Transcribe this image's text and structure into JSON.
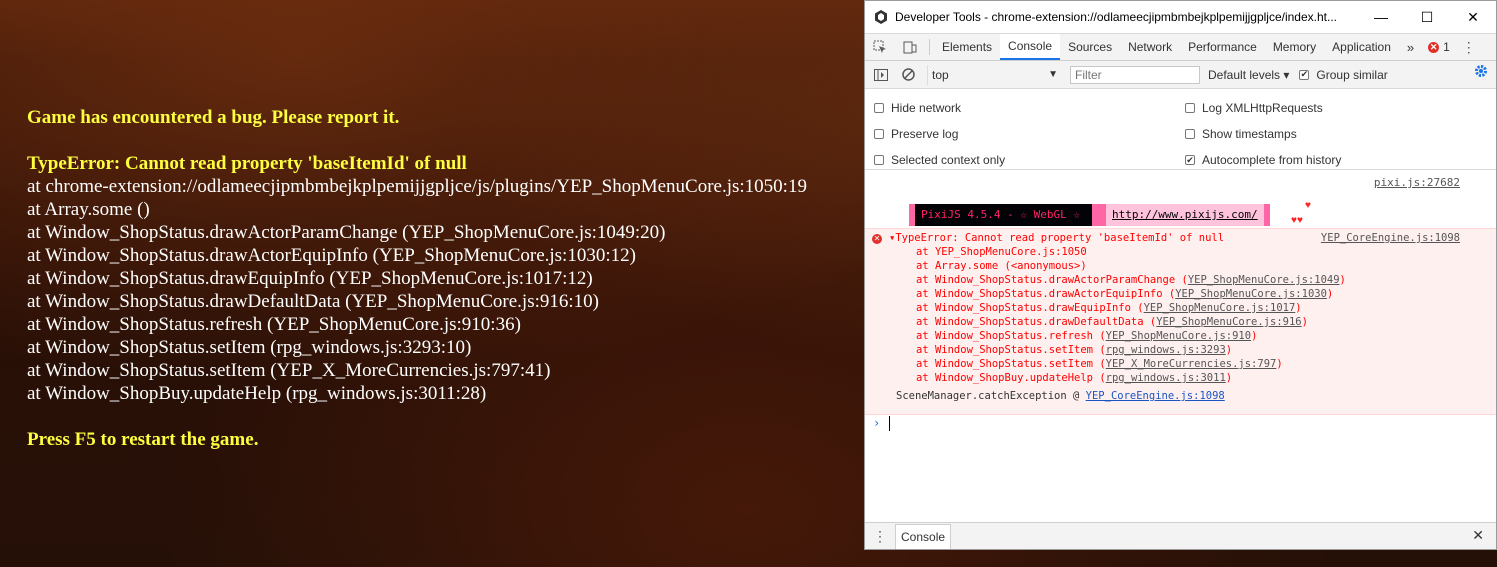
{
  "game": {
    "heading": "Game has encountered a bug. Please report it.",
    "error_title": "TypeError: Cannot read property 'baseItemId' of null",
    "stack": [
      "at chrome-extension://odlameecjipmbmbejkplpemijjgpljce/js/plugins/YEP_ShopMenuCore.js:1050:19",
      "at Array.some ()",
      "at Window_ShopStatus.drawActorParamChange (YEP_ShopMenuCore.js:1049:20)",
      "at Window_ShopStatus.drawActorEquipInfo (YEP_ShopMenuCore.js:1030:12)",
      "at Window_ShopStatus.drawEquipInfo (YEP_ShopMenuCore.js:1017:12)",
      "at Window_ShopStatus.drawDefaultData (YEP_ShopMenuCore.js:916:10)",
      "at Window_ShopStatus.refresh (YEP_ShopMenuCore.js:910:36)",
      "at Window_ShopStatus.setItem (rpg_windows.js:3293:10)",
      "at Window_ShopStatus.setItem (YEP_X_MoreCurrencies.js:797:41)",
      "at Window_ShopBuy.updateHelp (rpg_windows.js:3011:28)"
    ],
    "restart": "Press F5 to restart the game."
  },
  "devtools": {
    "window_title": "Developer Tools - chrome-extension://odlameecjipmbmbejkplpemijjgpljce/index.ht...",
    "win_minimize": "—",
    "win_maximize": "☐",
    "win_close": "✕",
    "tabs": [
      "Elements",
      "Console",
      "Sources",
      "Network",
      "Performance",
      "Memory",
      "Application"
    ],
    "more_tabs": "»",
    "error_count": "1",
    "context": "top",
    "filter_placeholder": "Filter",
    "levels": "Default levels ▾",
    "group_similar": "Group similar",
    "settings": {
      "hide_network": "Hide network",
      "preserve_log": "Preserve log",
      "selected_context": "Selected context only",
      "log_xhr": "Log XMLHttpRequests",
      "show_timestamps": "Show timestamps",
      "autocomplete": "Autocomplete from history"
    },
    "pixi_ref": "pixi.js:27682",
    "pixi_label": "PixiJS 4.5.4 - ☆ WebGL ☆",
    "pixi_url": "http://www.pixijs.com/",
    "pixi_hearts": "♥♥",
    "pixi_heart_single": "♥",
    "error": {
      "title": "▾TypeError: Cannot read property 'baseItemId' of null",
      "source": "YEP_CoreEngine.js:1098",
      "frames": [
        {
          "text": "at YEP_ShopMenuCore.js:1050",
          "ref": ""
        },
        {
          "text": "at Array.some (<anonymous>)",
          "ref": ""
        },
        {
          "text": "at Window_ShopStatus.drawActorParamChange (",
          "ref": "YEP_ShopMenuCore.js:1049",
          "close": ")"
        },
        {
          "text": "at Window_ShopStatus.drawActorEquipInfo (",
          "ref": "YEP_ShopMenuCore.js:1030",
          "close": ")"
        },
        {
          "text": "at Window_ShopStatus.drawEquipInfo (",
          "ref": "YEP_ShopMenuCore.js:1017",
          "close": ")"
        },
        {
          "text": "at Window_ShopStatus.drawDefaultData (",
          "ref": "YEP_ShopMenuCore.js:916",
          "close": ")"
        },
        {
          "text": "at Window_ShopStatus.refresh (",
          "ref": "YEP_ShopMenuCore.js:910",
          "close": ")"
        },
        {
          "text": "at Window_ShopStatus.setItem (",
          "ref": "rpg_windows.js:3293",
          "close": ")"
        },
        {
          "text": "at Window_ShopStatus.setItem (",
          "ref": "YEP_X_MoreCurrencies.js:797",
          "close": ")"
        },
        {
          "text": "at Window_ShopBuy.updateHelp (",
          "ref": "rpg_windows.js:3011",
          "close": ")"
        }
      ],
      "scene_manager": "SceneManager.catchException @ ",
      "scene_manager_ref": "YEP_CoreEngine.js:1098"
    },
    "prompt": "›",
    "drawer_tab": "Console",
    "drawer_close": "✕",
    "kebab": "⋮",
    "colors": {
      "accent": "#1a73e8",
      "error": "#ff0000",
      "game_text_highlight": "#ffff40"
    }
  }
}
